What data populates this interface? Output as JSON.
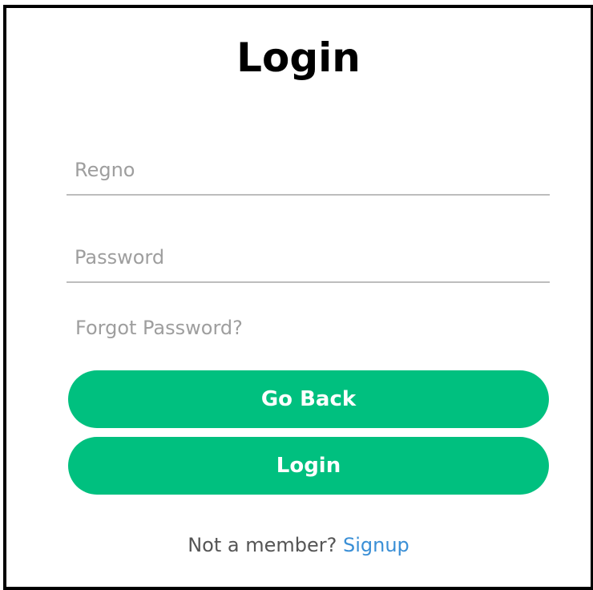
{
  "form": {
    "title": "Login",
    "regno": {
      "placeholder": "Regno",
      "value": ""
    },
    "password": {
      "placeholder": "Password",
      "value": ""
    },
    "forgot_label": "Forgot Password?",
    "go_back_label": "Go Back",
    "login_label": "Login",
    "signup_prompt": "Not a member?",
    "signup_label": "Signup"
  },
  "colors": {
    "primary_button": "#00c07f",
    "link": "#3a8fd6",
    "placeholder": "#9e9e9e",
    "frame_border": "#000000"
  }
}
